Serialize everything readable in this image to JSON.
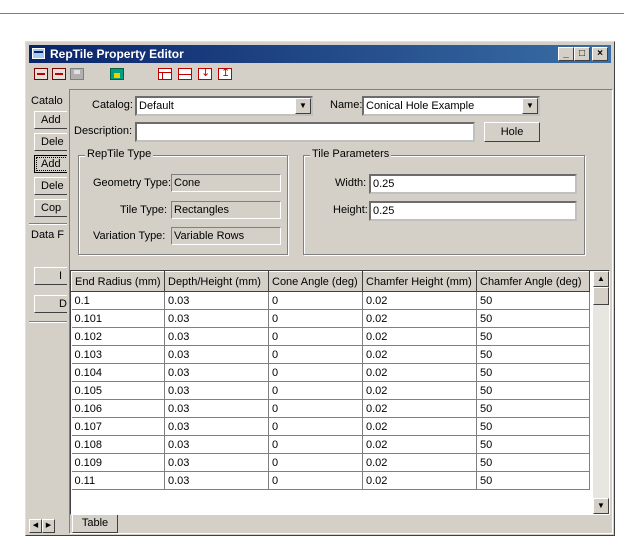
{
  "window": {
    "title": "RepTile Property Editor"
  },
  "toolbar": {
    "icons": [
      "red-window-icon",
      "red-window-close-icon",
      "save-disk-icon",
      "lock-icon",
      "panel-layout-icon",
      "panel-split-icon",
      "move-down-icon",
      "move-up-icon"
    ]
  },
  "left_panel": {
    "catalog_label": "Catalo",
    "buttons": [
      "Add",
      "Dele",
      "Add",
      "Dele",
      "Cop"
    ],
    "data_label": "Data F",
    "buttons2": [
      "I",
      "D"
    ]
  },
  "form": {
    "catalog_label": "Catalog:",
    "catalog_value": "Default",
    "name_label": "Name:",
    "name_value": "Conical Hole Example",
    "description_label": "Description:",
    "description_value": "",
    "hole_button": "Hole"
  },
  "reptile_type": {
    "title": "RepTile Type",
    "geometry_label": "Geometry Type:",
    "geometry_value": "Cone",
    "tile_label": "Tile Type:",
    "tile_value": "Rectangles",
    "variation_label": "Variation Type:",
    "variation_value": "Variable Rows"
  },
  "tile_params": {
    "title": "Tile Parameters",
    "width_label": "Width:",
    "width_value": "0.25",
    "height_label": "Height:",
    "height_value": "0.25"
  },
  "table": {
    "columns": [
      "End Radius (mm)",
      "Depth/Height (mm)",
      "Cone Angle (deg)",
      "Chamfer Height (mm)",
      "Chamfer Angle (deg)"
    ],
    "rows": [
      [
        "0.1",
        "0.03",
        "0",
        "0.02",
        "50"
      ],
      [
        "0.101",
        "0.03",
        "0",
        "0.02",
        "50"
      ],
      [
        "0.102",
        "0.03",
        "0",
        "0.02",
        "50"
      ],
      [
        "0.103",
        "0.03",
        "0",
        "0.02",
        "50"
      ],
      [
        "0.104",
        "0.03",
        "0",
        "0.02",
        "50"
      ],
      [
        "0.105",
        "0.03",
        "0",
        "0.02",
        "50"
      ],
      [
        "0.106",
        "0.03",
        "0",
        "0.02",
        "50"
      ],
      [
        "0.107",
        "0.03",
        "0",
        "0.02",
        "50"
      ],
      [
        "0.108",
        "0.03",
        "0",
        "0.02",
        "50"
      ],
      [
        "0.109",
        "0.03",
        "0",
        "0.02",
        "50"
      ],
      [
        "0.11",
        "0.03",
        "0",
        "0.02",
        "50"
      ]
    ],
    "tab_label": "Table"
  },
  "colors": {
    "titlebar_start": "#0a246a",
    "titlebar_end": "#3a6ea5",
    "face": "#d4d0c8"
  }
}
